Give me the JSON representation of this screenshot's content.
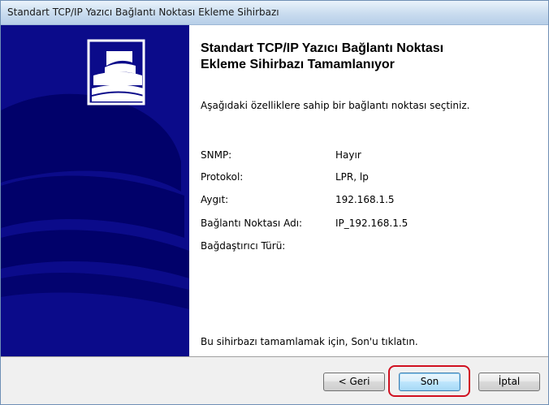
{
  "window": {
    "title": "Standart TCP/IP Yazıcı Bağlantı Noktası Ekleme Sihirbazı"
  },
  "content": {
    "heading_line1": "Standart TCP/IP Yazıcı Bağlantı Noktası",
    "heading_line2": "Ekleme Sihirbazı Tamamlanıyor",
    "intro": "Aşağıdaki özelliklere sahip bir bağlantı noktası seçtiniz.",
    "properties": [
      {
        "label": "SNMP:",
        "value": "Hayır"
      },
      {
        "label": "Protokol:",
        "value": "LPR, lp"
      },
      {
        "label": "Aygıt:",
        "value": "192.168.1.5"
      },
      {
        "label": "Bağlantı Noktası Adı:",
        "value": "IP_192.168.1.5"
      },
      {
        "label": "Bağdaştırıcı Türü:",
        "value": ""
      }
    ],
    "finish_note": "Bu sihirbazı tamamlamak için, Son'u tıklatın."
  },
  "buttons": {
    "back": "< Geri",
    "finish": "Son",
    "cancel": "İptal"
  },
  "colors": {
    "sidebar_bg": "#0b0b8a",
    "highlight": "#d01020",
    "default_button_border": "#3c7fb1"
  }
}
